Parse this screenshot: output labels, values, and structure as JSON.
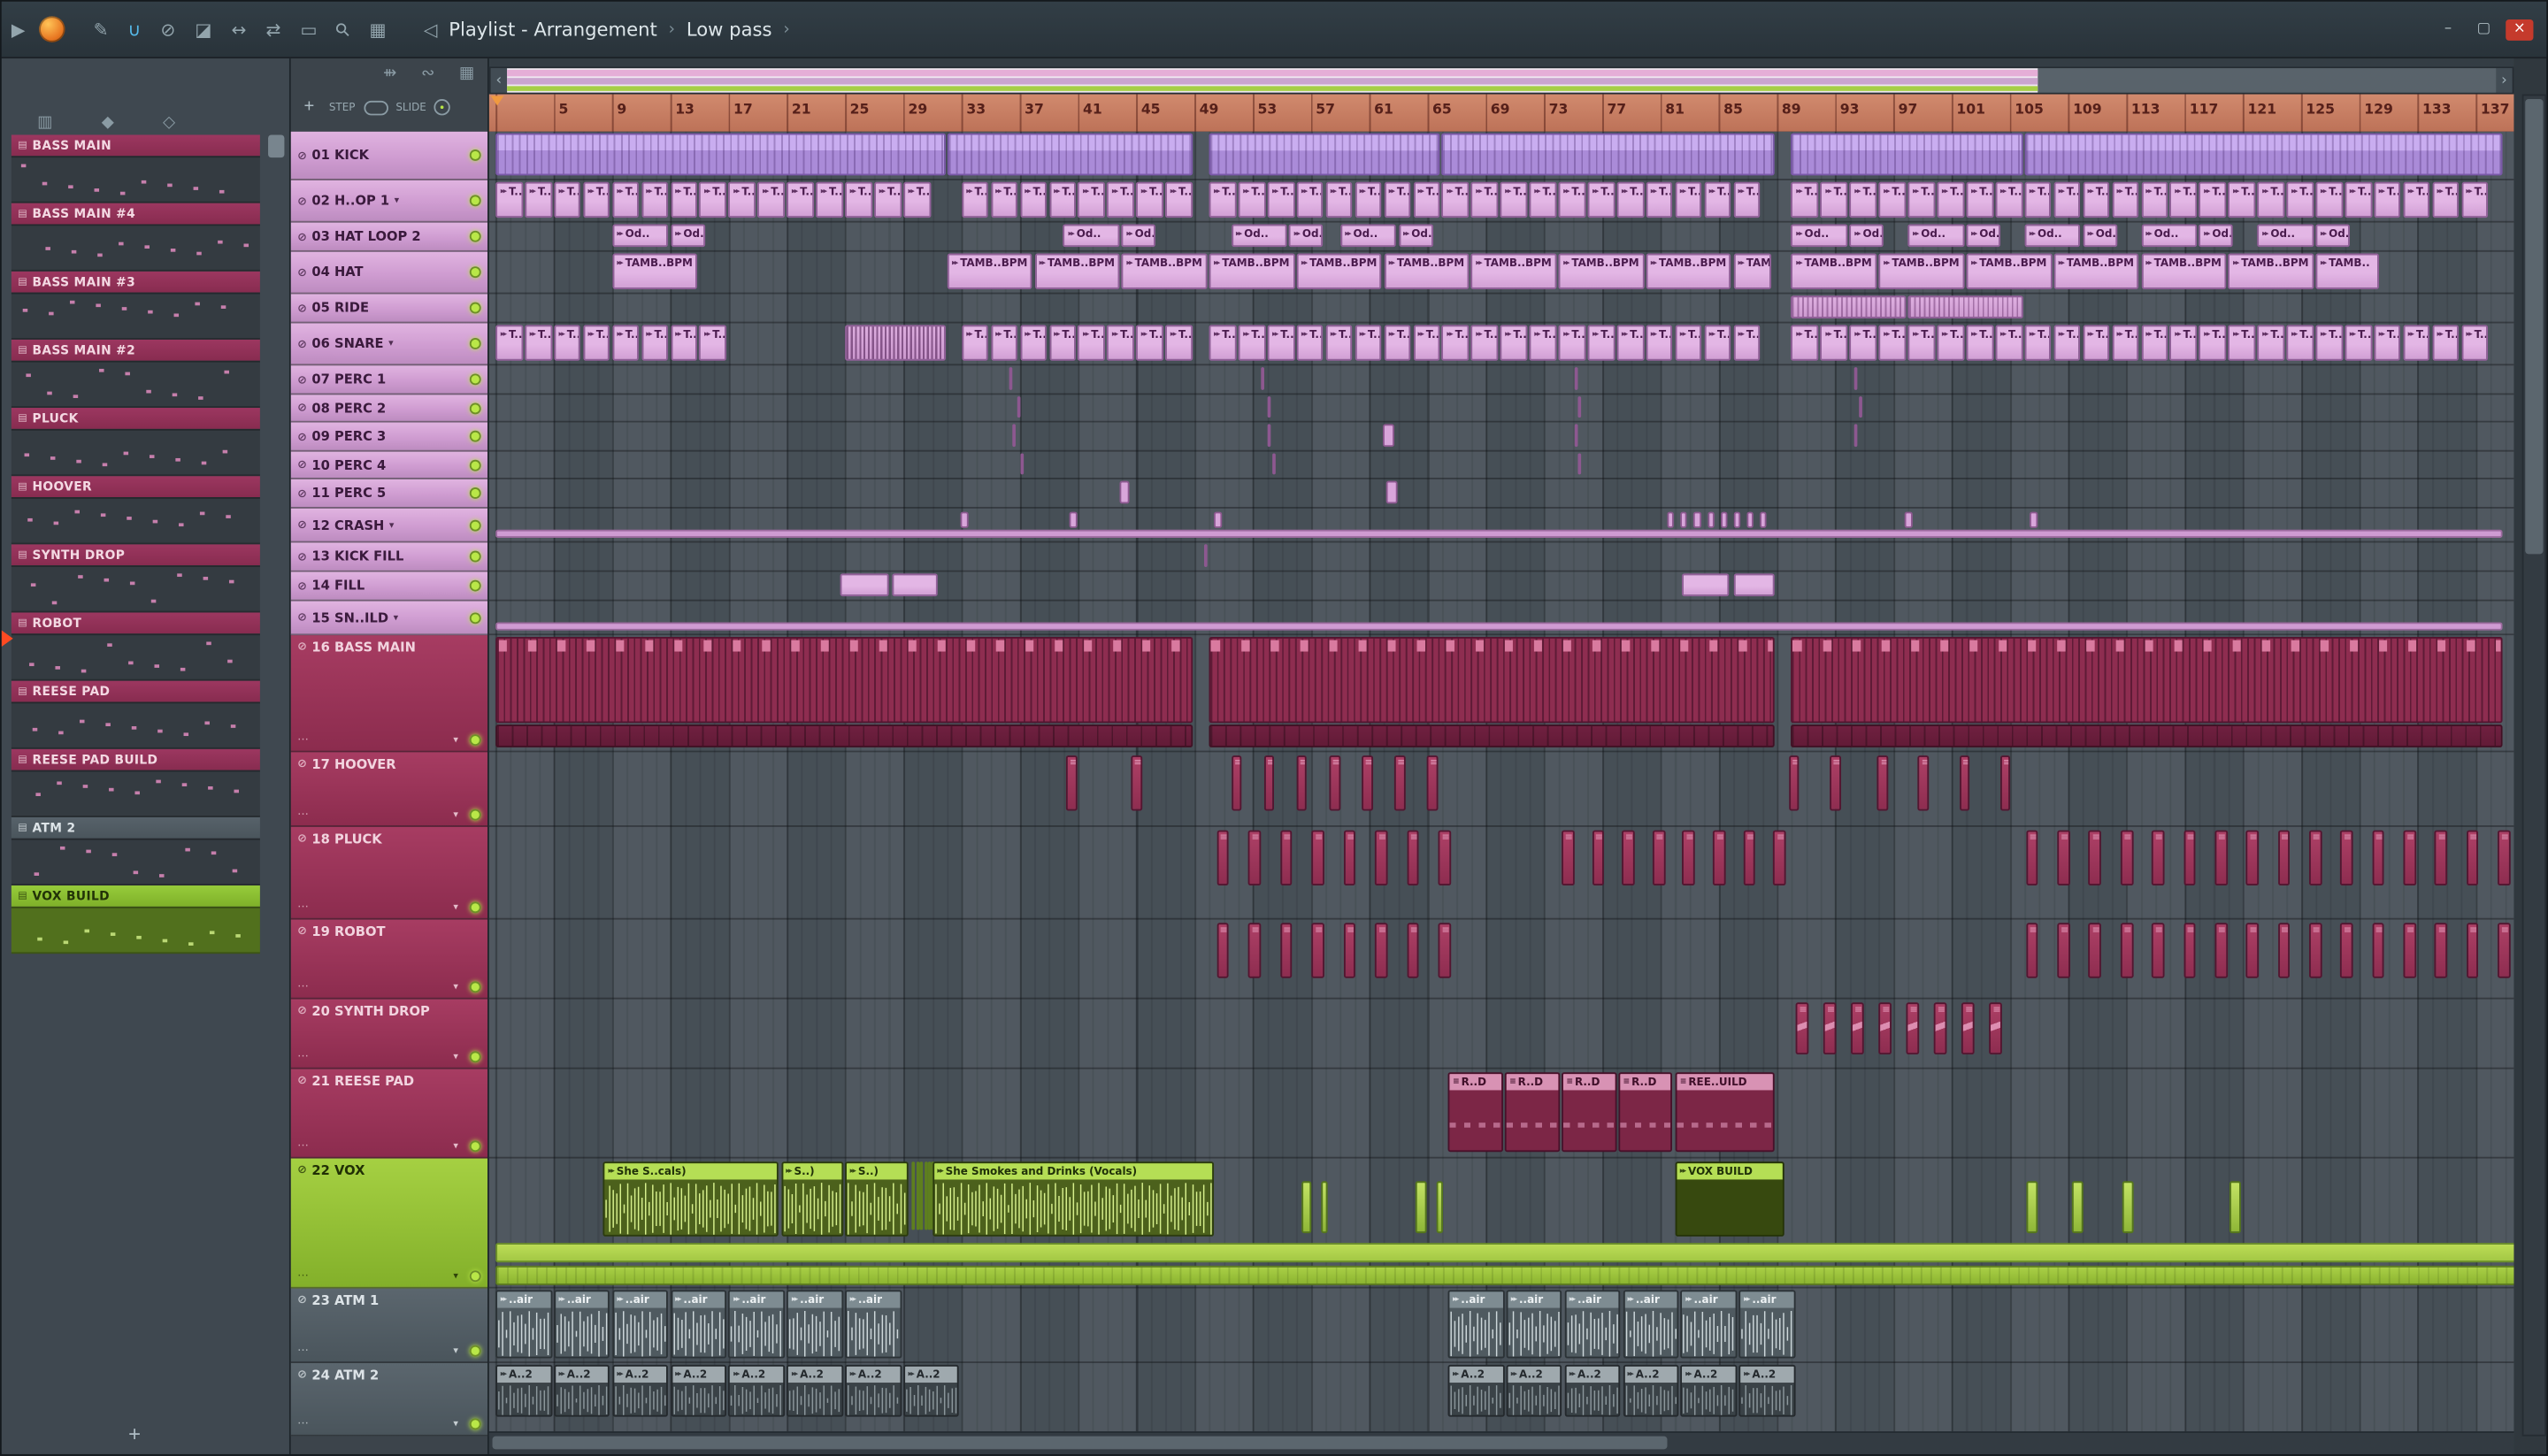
{
  "window": {
    "minimize": "–",
    "maximize": "▢",
    "close": "×"
  },
  "titlebar": {
    "title": "Playlist - Arrangement",
    "subtitle": "Low pass",
    "tools": [
      {
        "name": "draw-tool-icon",
        "glyph": "✎",
        "accent": false
      },
      {
        "name": "snap-magnet-icon",
        "glyph": "∪",
        "accent": true
      },
      {
        "name": "delete-tool-icon",
        "glyph": "⊘",
        "accent": false
      },
      {
        "name": "mute-tool-icon",
        "glyph": "◪",
        "accent": false
      },
      {
        "name": "slip-tool-icon",
        "glyph": "↔",
        "accent": false
      },
      {
        "name": "slide-tool-icon",
        "glyph": "⇄",
        "accent": false
      },
      {
        "name": "select-tool-icon",
        "glyph": "▭",
        "accent": false
      },
      {
        "name": "zoom-tool-icon",
        "glyph": "⚲",
        "accent": false,
        "rot": true
      },
      {
        "name": "playback-tool-icon",
        "glyph": "▦",
        "accent": false
      }
    ]
  },
  "glyphs": {
    "play": "▶",
    "speaker": "◁",
    "chevronLeft": "‹",
    "chevronRight": "›",
    "mute": "⊘",
    "arrowDown": "▾",
    "dots": "⋯",
    "plus": "+",
    "clip": "▸▸",
    "note": "≡",
    "patIcon": "▤"
  },
  "picker": {
    "add": "+",
    "tools": [
      {
        "name": "pattern-view-icon",
        "glyph": "▥"
      },
      {
        "name": "audio-view-icon",
        "glyph": "◆"
      },
      {
        "name": "automation-view-icon",
        "glyph": "◇"
      }
    ],
    "items": [
      {
        "label": "BASS MAIN",
        "style": "maroon"
      },
      {
        "label": "BASS MAIN #4",
        "style": "maroon"
      },
      {
        "label": "BASS MAIN #3",
        "style": "maroon"
      },
      {
        "label": "BASS MAIN #2",
        "style": "maroon"
      },
      {
        "label": "PLUCK",
        "style": "maroon"
      },
      {
        "label": "HOOVER",
        "style": "maroon"
      },
      {
        "label": "SYNTH DROP",
        "style": "maroon"
      },
      {
        "label": "ROBOT",
        "style": "maroon"
      },
      {
        "label": "REESE PAD",
        "style": "maroon"
      },
      {
        "label": "REESE PAD BUILD",
        "style": "maroon"
      },
      {
        "label": "ATM 2",
        "style": "gray"
      },
      {
        "label": "VOX BUILD",
        "style": "green",
        "selected": true
      }
    ]
  },
  "tracks_bar": {
    "add": "+",
    "step": "STEP",
    "slide": "SLIDE",
    "icons": [
      {
        "name": "performance-mode-icon",
        "glyph": "⇻"
      },
      {
        "name": "link-icon",
        "glyph": "∾"
      },
      {
        "name": "keyboard-icon",
        "glyph": "▦"
      }
    ]
  },
  "ruler": {
    "numbers": [
      5,
      9,
      13,
      17,
      21,
      25,
      29,
      33,
      37,
      41,
      45,
      49,
      53,
      57,
      61,
      65,
      69,
      73,
      77,
      81,
      85,
      89,
      93,
      97,
      101,
      105,
      109,
      113,
      117,
      121,
      125,
      129,
      133,
      137
    ]
  },
  "tracks": [
    {
      "num": "01",
      "name": "KICK",
      "h": 30,
      "style": "pink"
    },
    {
      "num": "02",
      "name": "H..OP 1",
      "h": 26,
      "style": "pink",
      "arrow": true
    },
    {
      "num": "03",
      "name": "HAT LOOP 2",
      "h": 18,
      "style": "pink"
    },
    {
      "num": "04",
      "name": "HAT",
      "h": 26,
      "style": "pink"
    },
    {
      "num": "05",
      "name": "RIDE",
      "h": 18,
      "style": "pink"
    },
    {
      "num": "06",
      "name": "SNARE",
      "h": 26,
      "style": "pink",
      "arrow": true
    },
    {
      "num": "07",
      "name": "PERC 1",
      "h": 18,
      "style": "pink"
    },
    {
      "num": "08",
      "name": "PERC 2",
      "h": 17,
      "style": "pink"
    },
    {
      "num": "09",
      "name": "PERC 3",
      "h": 18,
      "style": "pink"
    },
    {
      "num": "10",
      "name": "PERC 4",
      "h": 17,
      "style": "pink"
    },
    {
      "num": "11",
      "name": "PERC 5",
      "h": 18,
      "style": "pink"
    },
    {
      "num": "12",
      "name": "CRASH",
      "h": 21,
      "style": "pink",
      "arrow": true
    },
    {
      "num": "13",
      "name": "KICK FILL",
      "h": 18,
      "style": "pink"
    },
    {
      "num": "14",
      "name": "FILL",
      "h": 18,
      "style": "pink"
    },
    {
      "num": "15",
      "name": "SN..ILD",
      "h": 21,
      "style": "pink",
      "arrow": true
    },
    {
      "num": "16",
      "name": "BASS MAIN",
      "h": 72,
      "style": "maroon"
    },
    {
      "num": "17",
      "name": "HOOVER",
      "h": 46,
      "style": "maroon"
    },
    {
      "num": "18",
      "name": "PLUCK",
      "h": 57,
      "style": "maroon"
    },
    {
      "num": "19",
      "name": "ROBOT",
      "h": 49,
      "style": "maroon"
    },
    {
      "num": "20",
      "name": "SYNTH DROP",
      "h": 43,
      "style": "maroon"
    },
    {
      "num": "21",
      "name": "REESE PAD",
      "h": 55,
      "style": "maroon"
    },
    {
      "num": "22",
      "name": "VOX",
      "h": 80,
      "style": "green"
    },
    {
      "num": "23",
      "name": "ATM 1",
      "h": 46,
      "style": "gray"
    },
    {
      "num": "24",
      "name": "ATM 2",
      "h": 45,
      "style": "gray"
    }
  ],
  "clips": [
    {
      "t": 1,
      "b": 1,
      "w": 31,
      "k": "kick"
    },
    {
      "t": 1,
      "b": 32,
      "w": 17,
      "k": "kick"
    },
    {
      "t": 1,
      "b": 50,
      "w": 16,
      "k": "kick"
    },
    {
      "t": 1,
      "b": 66,
      "w": 23,
      "k": "kick"
    },
    {
      "t": 1,
      "b": 90,
      "w": 16,
      "k": "kick"
    },
    {
      "t": 1,
      "b": 106,
      "w": 33,
      "k": "kick"
    },
    {
      "t": 2,
      "b": 1,
      "w": 2,
      "n": 15,
      "s": 2,
      "k": "pat",
      "l": "T..M"
    },
    {
      "t": 2,
      "b": 33,
      "w": 2,
      "n": 8,
      "s": 2,
      "k": "pat",
      "l": "T..M"
    },
    {
      "t": 2,
      "b": 50,
      "w": 2,
      "n": 19,
      "s": 2,
      "k": "pat",
      "l": "T..M"
    },
    {
      "t": 2,
      "b": 90,
      "w": 2,
      "n": 24,
      "s": 2,
      "k": "pat",
      "l": "T..M"
    },
    {
      "t": 3,
      "b": 9,
      "w": 4,
      "k": "pat",
      "l": "Od.."
    },
    {
      "t": 3,
      "b": 13,
      "w": 2.5,
      "k": "pat",
      "l": "Od.."
    },
    {
      "t": 3,
      "b": 40,
      "w": 4,
      "k": "pat",
      "l": "Od.."
    },
    {
      "t": 3,
      "b": 44,
      "w": 2.5,
      "k": "pat",
      "l": "Od.."
    },
    {
      "t": 3,
      "b": 51.5,
      "w": 4,
      "n": 2,
      "s": 7.5,
      "k": "pat",
      "l": "Od.."
    },
    {
      "t": 3,
      "b": 55.5,
      "w": 2.5,
      "n": 2,
      "s": 7.5,
      "k": "pat",
      "l": "Od.."
    },
    {
      "t": 3,
      "b": 90,
      "w": 4,
      "n": 5,
      "s": 8,
      "k": "pat",
      "l": "Od.."
    },
    {
      "t": 3,
      "b": 94,
      "w": 2.5,
      "n": 5,
      "s": 8,
      "k": "pat",
      "l": "Od.."
    },
    {
      "t": 4,
      "b": 9,
      "w": 6,
      "k": "pat",
      "l": "TAMB..BPM"
    },
    {
      "t": 4,
      "b": 32,
      "w": 6,
      "n": 3,
      "s": 6,
      "k": "pat",
      "l": "TAMB..BPM"
    },
    {
      "t": 4,
      "b": 50,
      "w": 6,
      "n": 6,
      "s": 6,
      "k": "pat",
      "l": "TAMB..BPM"
    },
    {
      "t": 4,
      "b": 86,
      "w": 2.7,
      "k": "pat",
      "l": "TAM.."
    },
    {
      "t": 4,
      "b": 90,
      "w": 6,
      "n": 6,
      "s": 6,
      "k": "pat",
      "l": "TAMB..BPM"
    },
    {
      "t": 4,
      "b": 126,
      "w": 4.5,
      "k": "pat",
      "l": "TAMB.."
    },
    {
      "t": 5,
      "b": 90,
      "w": 8,
      "n": 2,
      "s": 8,
      "k": "ride"
    },
    {
      "t": 6,
      "b": 1,
      "w": 2,
      "n": 8,
      "s": 2,
      "k": "pat",
      "l": "T..M"
    },
    {
      "t": 6,
      "b": 25,
      "w": 7,
      "k": "stripes"
    },
    {
      "t": 6,
      "b": 33,
      "w": 2,
      "n": 8,
      "s": 2,
      "k": "pat",
      "l": "T..M"
    },
    {
      "t": 6,
      "b": 50,
      "w": 2,
      "n": 19,
      "s": 2,
      "k": "pat",
      "l": "T..M"
    },
    {
      "t": 6,
      "b": 90,
      "w": 2,
      "n": 24,
      "s": 2,
      "k": "pat",
      "l": "T..M"
    },
    {
      "t": 7,
      "b": 36.3,
      "w": 0.35,
      "k": "mark"
    },
    {
      "t": 7,
      "b": 53.6,
      "w": 0.35,
      "k": "mark"
    },
    {
      "t": 7,
      "b": 75.1,
      "w": 0.35,
      "k": "mark"
    },
    {
      "t": 7,
      "b": 94.3,
      "w": 0.35,
      "k": "mark"
    },
    {
      "t": 8,
      "b": 36.8,
      "w": 0.35,
      "k": "mark"
    },
    {
      "t": 8,
      "b": 54,
      "w": 0.35,
      "k": "mark"
    },
    {
      "t": 8,
      "b": 75.3,
      "w": 0.35,
      "k": "mark"
    },
    {
      "t": 8,
      "b": 94.6,
      "w": 0.35,
      "k": "mark"
    },
    {
      "t": 9,
      "b": 36.5,
      "w": 0.35,
      "k": "mark"
    },
    {
      "t": 9,
      "b": 54,
      "w": 0.35,
      "k": "mark"
    },
    {
      "t": 9,
      "b": 61.9,
      "w": 0.9,
      "k": "mark"
    },
    {
      "t": 9,
      "b": 75.1,
      "w": 0.35,
      "k": "mark"
    },
    {
      "t": 9,
      "b": 94.3,
      "w": 0.35,
      "k": "mark"
    },
    {
      "t": 10,
      "b": 37,
      "w": 0.35,
      "k": "mark"
    },
    {
      "t": 10,
      "b": 54.3,
      "w": 0.35,
      "k": "mark"
    },
    {
      "t": 10,
      "b": 75.3,
      "w": 0.35,
      "k": "mark"
    },
    {
      "t": 11,
      "b": 43.8,
      "w": 0.8,
      "k": "mark"
    },
    {
      "t": 11,
      "b": 62.2,
      "w": 0.9,
      "k": "mark"
    },
    {
      "t": 12,
      "b": 1,
      "w": 138,
      "k": "lane"
    },
    {
      "t": 12,
      "b": 32.9,
      "w": 0.7,
      "k": "cmark"
    },
    {
      "t": 12,
      "b": 40.4,
      "w": 0.7,
      "k": "cmark"
    },
    {
      "t": 12,
      "b": 50.3,
      "w": 0.7,
      "k": "cmark"
    },
    {
      "t": 12,
      "b": 81.5,
      "w": 0.6,
      "n": 8,
      "s": 0.9,
      "k": "cmark"
    },
    {
      "t": 12,
      "b": 97.8,
      "w": 0.7,
      "k": "cmark"
    },
    {
      "t": 12,
      "b": 106.4,
      "w": 0.7,
      "k": "cmark"
    },
    {
      "t": 13,
      "b": 49.6,
      "w": 0.4,
      "k": "mark"
    },
    {
      "t": 14,
      "b": 24.7,
      "w": 3.4,
      "k": "pat2"
    },
    {
      "t": 14,
      "b": 28.2,
      "w": 3.3,
      "k": "pat2"
    },
    {
      "t": 14,
      "b": 82.5,
      "w": 3.4,
      "k": "pat2"
    },
    {
      "t": 14,
      "b": 86,
      "w": 3,
      "k": "pat2"
    },
    {
      "t": 15,
      "b": 1,
      "w": 138,
      "k": "lane"
    },
    {
      "t": 16,
      "b": 1,
      "w": 48,
      "k": "bass"
    },
    {
      "t": 16,
      "b": 50,
      "w": 39,
      "k": "bass"
    },
    {
      "t": 16,
      "b": 90,
      "w": 49,
      "k": "bass"
    },
    {
      "t": 16,
      "b": 1,
      "w": 48,
      "k": "basslane"
    },
    {
      "t": 16,
      "b": 50,
      "w": 39,
      "k": "basslane"
    },
    {
      "t": 16,
      "b": 90,
      "w": 49,
      "k": "basslane"
    },
    {
      "t": 17,
      "b": 40.2,
      "w": 0.9,
      "k": "note"
    },
    {
      "t": 17,
      "b": 44.6,
      "w": 0.9,
      "k": "note"
    },
    {
      "t": 17,
      "b": 51.5,
      "w": 0.9,
      "n": 7,
      "s": 2.24,
      "k": "note"
    },
    {
      "t": 17,
      "b": 89.8,
      "w": 0.9,
      "k": "note"
    },
    {
      "t": 17,
      "b": 92.6,
      "w": 0.9,
      "k": "note"
    },
    {
      "t": 17,
      "b": 95.9,
      "w": 0.9,
      "n": 4,
      "s": 2.8,
      "k": "note"
    },
    {
      "t": 18,
      "b": 50.5,
      "w": 1,
      "n": 8,
      "s": 2.18,
      "k": "note"
    },
    {
      "t": 18,
      "b": 74.2,
      "w": 1,
      "n": 8,
      "s": 2.08,
      "k": "note"
    },
    {
      "t": 18,
      "b": 106.1,
      "w": 1,
      "n": 16,
      "s": 2.16,
      "k": "note"
    },
    {
      "t": 19,
      "b": 50.5,
      "w": 1,
      "n": 8,
      "s": 2.18,
      "k": "note"
    },
    {
      "t": 19,
      "b": 106.1,
      "w": 1,
      "n": 16,
      "s": 2.16,
      "k": "note"
    },
    {
      "t": 20,
      "b": 90.3,
      "w": 1,
      "n": 8,
      "s": 1.9,
      "k": "synth"
    },
    {
      "t": 21,
      "b": 66.4,
      "w": 3.9,
      "n": 4,
      "s": 3.9,
      "k": "reese",
      "l": "R..D"
    },
    {
      "t": 21,
      "b": 82,
      "w": 7,
      "k": "reese",
      "l": "REE..UILD"
    },
    {
      "t": 22,
      "b": 8.4,
      "w": 12.2,
      "k": "audio",
      "l": "She S..cals)"
    },
    {
      "t": 22,
      "b": 20.6,
      "w": 4.4,
      "k": "audio",
      "l": "S..)"
    },
    {
      "t": 22,
      "b": 25,
      "w": 4.5,
      "k": "audio",
      "l": "S..)"
    },
    {
      "t": 22,
      "b": 29.6,
      "w": 0.22,
      "n": 6,
      "s": 0.27,
      "k": "vmark"
    },
    {
      "t": 22,
      "b": 31,
      "w": 19.5,
      "k": "audio",
      "l": "She Smokes and Drinks (Vocals)"
    },
    {
      "t": 22,
      "b": 56.3,
      "w": 0.9,
      "k": "vblock"
    },
    {
      "t": 22,
      "b": 57.7,
      "w": 0.6,
      "k": "vblock"
    },
    {
      "t": 22,
      "b": 64.2,
      "w": 0.9,
      "k": "vblock"
    },
    {
      "t": 22,
      "b": 65.6,
      "w": 0.6,
      "k": "vblock"
    },
    {
      "t": 22,
      "b": 82,
      "w": 7.6,
      "k": "voxbuild",
      "l": "VOX BUILD"
    },
    {
      "t": 22,
      "b": 106.1,
      "w": 0.9,
      "k": "vblock"
    },
    {
      "t": 22,
      "b": 109.3,
      "w": 0.9,
      "k": "vblock"
    },
    {
      "t": 22,
      "b": 112.7,
      "w": 0.9,
      "k": "vblock"
    },
    {
      "t": 22,
      "b": 120.1,
      "w": 0.9,
      "k": "vblock"
    },
    {
      "t": 22,
      "b": 1,
      "w": 139,
      "k": "lime1"
    },
    {
      "t": 22,
      "b": 1,
      "w": 139,
      "k": "lime2"
    },
    {
      "t": 23,
      "b": 1,
      "w": 4,
      "n": 7,
      "s": 4,
      "k": "atm",
      "l": "..air"
    },
    {
      "t": 23,
      "b": 66.4,
      "w": 4,
      "n": 6,
      "s": 4,
      "k": "atm",
      "l": "..air"
    },
    {
      "t": 24,
      "b": 1,
      "w": 4,
      "n": 8,
      "s": 4,
      "k": "atm2",
      "l": "A..2"
    },
    {
      "t": 24,
      "b": 66.4,
      "w": 4,
      "n": 6,
      "s": 4,
      "k": "atm2",
      "l": "A..2"
    }
  ],
  "colors": {
    "pattern_pink": "#d9a6dc",
    "kick_violet": "#ab8cd8",
    "bass_maroon": "#8e2d50",
    "audio_lime": "#a8d243",
    "atm_gray": "#5c686d",
    "ruler_salmon": "#c87a5e",
    "selected_green": "#8fc436",
    "led_green": "#b9e748"
  }
}
